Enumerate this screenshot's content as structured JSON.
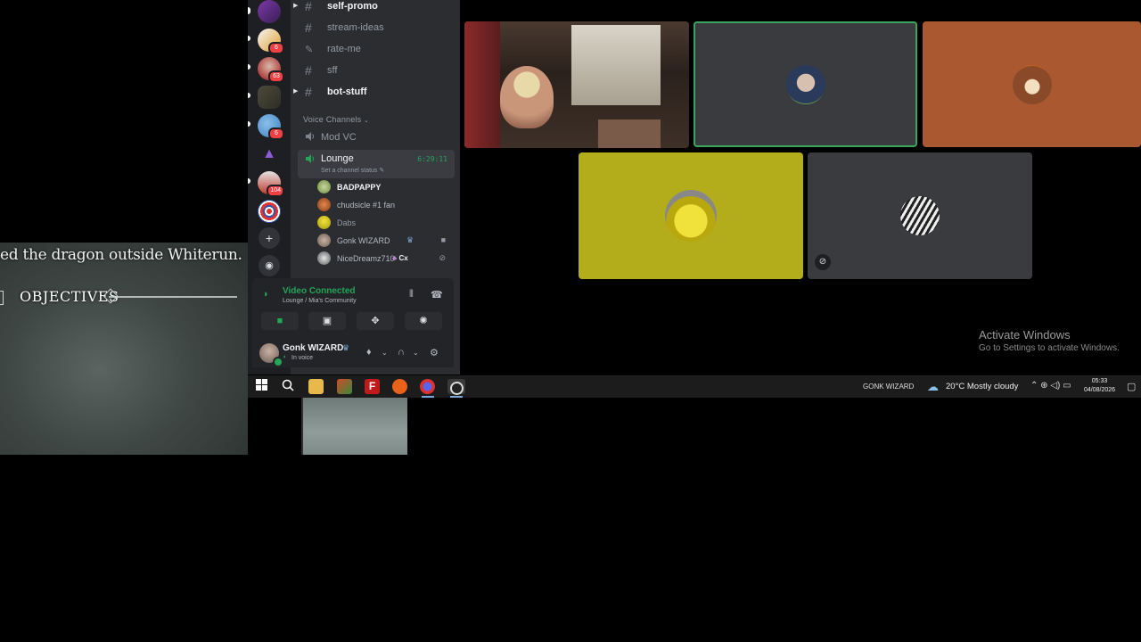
{
  "game": {
    "quest_text": "ed the dragon outside Whiterun.",
    "objectives_label": "OBJECTIVES"
  },
  "rail": {
    "badges": [
      "6",
      "63",
      "6",
      "104"
    ],
    "add_icon": "plus-icon",
    "discover_icon": "compass-icon"
  },
  "channels": {
    "text": [
      {
        "name": "self-promo",
        "unread": true
      },
      {
        "name": "stream-ideas",
        "unread": false
      },
      {
        "name": "rate-me",
        "unread": false
      },
      {
        "name": "sff",
        "unread": false
      },
      {
        "name": "bot-stuff",
        "unread": true
      }
    ],
    "voice_category": "Voice Channels",
    "voice": [
      {
        "name": "Mod VC"
      },
      {
        "name": "Lounge",
        "timer": "6:29:11",
        "status": "Set a channel status"
      }
    ],
    "members": [
      {
        "name": "BADPAPPY",
        "tag": ""
      },
      {
        "name": "chudsicle #1 fan",
        "tag": ""
      },
      {
        "name": "Dabs",
        "tag": ""
      },
      {
        "name": "Gonk WIZARD",
        "tag": ""
      },
      {
        "name": "NiceDreamz710",
        "tag": "Cx"
      }
    ]
  },
  "voice_panel": {
    "title": "Video Connected",
    "subtitle": "Lounge / Mia's Community"
  },
  "user_panel": {
    "name": "Gonk WIZARD",
    "status": "In voice"
  },
  "activate": {
    "title": "Activate Windows",
    "subtitle": "Go to Settings to activate Windows."
  },
  "taskbar": {
    "user": "GONK WIZARD",
    "weather": "20°C  Mostly cloudy",
    "time": "05:33",
    "date": "04/08/2026"
  },
  "colors": {
    "discord_green": "#23a55a",
    "tile_gray": "#3a3b3e",
    "tile_orange": "#a9582f",
    "tile_yellow": "#b3ad1c",
    "speaking_border": "#3ba55d"
  }
}
